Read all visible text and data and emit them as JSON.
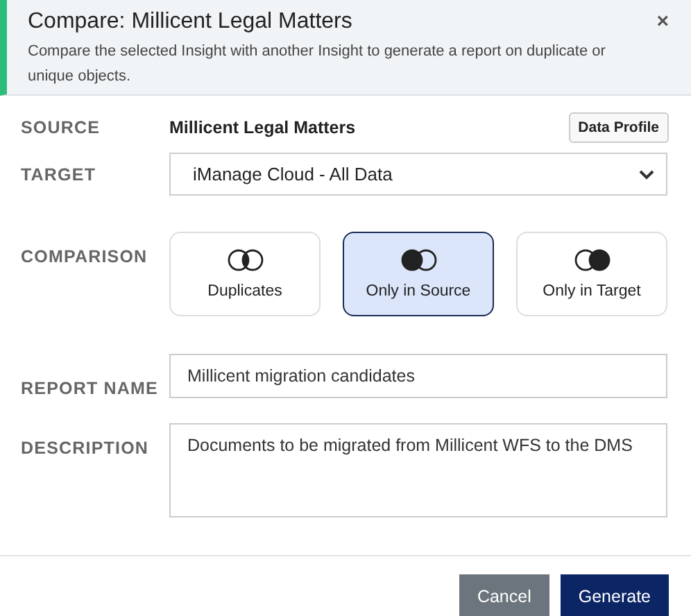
{
  "header": {
    "title": "Compare: Millicent Legal Matters",
    "subtitle": "Compare the selected Insight with another Insight to generate a report on duplicate or unique objects.",
    "close": "×"
  },
  "source": {
    "label": "SOURCE",
    "value": "Millicent Legal Matters",
    "button": "Data Profile"
  },
  "target": {
    "label": "TARGET",
    "value": "iManage Cloud - All Data"
  },
  "comparison": {
    "label": "COMPARISON",
    "options": [
      {
        "kind": "duplicates",
        "label": "Duplicates",
        "selected": false
      },
      {
        "kind": "source",
        "label": "Only in Source",
        "selected": true
      },
      {
        "kind": "target",
        "label": "Only in Target",
        "selected": false
      }
    ]
  },
  "report_name": {
    "label": "REPORT NAME",
    "value": "Millicent migration candidates"
  },
  "description": {
    "label": "DESCRIPTION",
    "value": "Documents to be migrated from Millicent WFS to the DMS"
  },
  "buttons": [
    {
      "kind": "secondary",
      "label": "Cancel"
    },
    {
      "kind": "primary",
      "label": "Generate"
    }
  ]
}
